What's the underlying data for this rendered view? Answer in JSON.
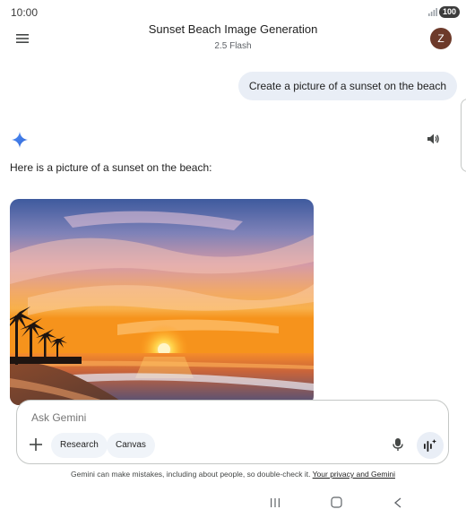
{
  "status_bar": {
    "time": "10:00",
    "battery": "100",
    "signal_icon": "signal-icon"
  },
  "header": {
    "title": "Sunset Beach Image Generation",
    "model": "2.5 Flash",
    "avatar_letter": "Z",
    "menu_icon": "menu-icon"
  },
  "conversation": {
    "user_message": "Create a picture of a sunset on the beach",
    "response_text": "Here is a picture of a sunset on the beach:",
    "image_alt": "sunset on the beach"
  },
  "input": {
    "placeholder": "Ask Gemini",
    "chips": [
      {
        "label": "Research"
      },
      {
        "label": "Canvas"
      }
    ]
  },
  "footer": {
    "disclaimer": "Gemini can make mistakes, including about people, so double-check it.",
    "privacy_link": "Your privacy and Gemini"
  },
  "colors": {
    "accent": "#4285f4",
    "avatar_bg": "#6d3a2a",
    "bubble_bg": "#e9eef6"
  }
}
